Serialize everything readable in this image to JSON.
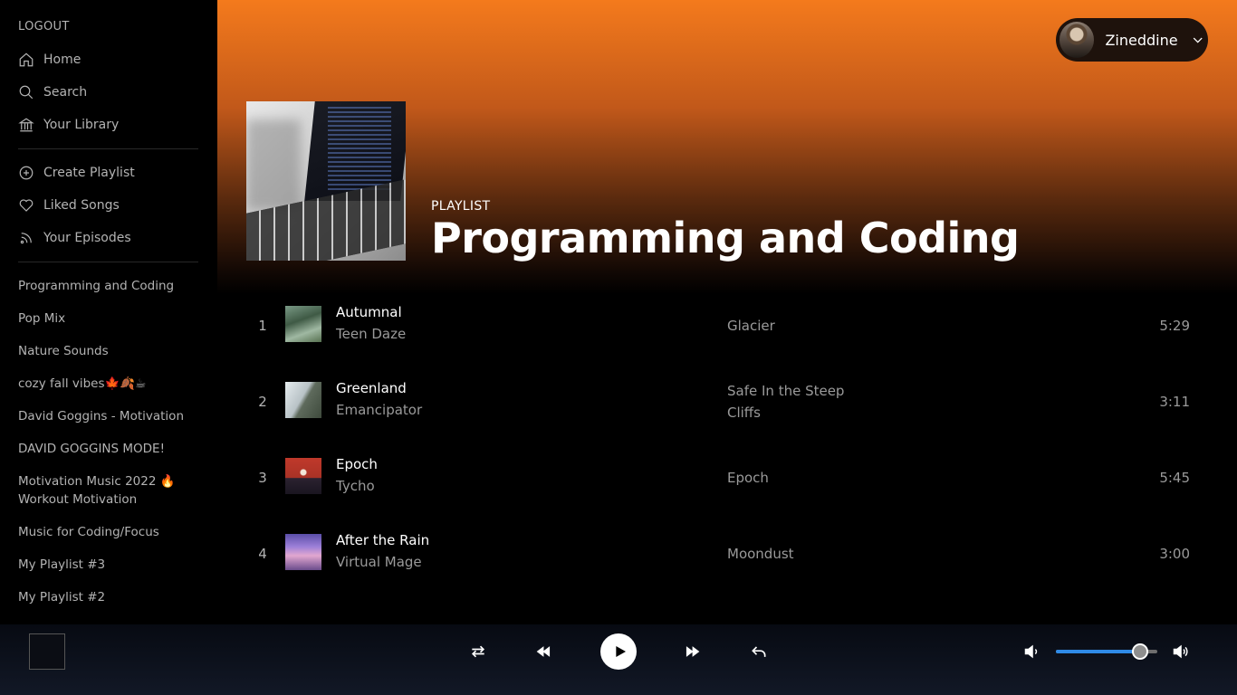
{
  "sidebar": {
    "logout_label": "LOGOUT",
    "nav": [
      {
        "label": "Home",
        "icon": "home-icon"
      },
      {
        "label": "Search",
        "icon": "search-icon"
      },
      {
        "label": "Your Library",
        "icon": "library-icon"
      }
    ],
    "actions": [
      {
        "label": "Create Playlist",
        "icon": "plus-circle-icon"
      },
      {
        "label": "Liked Songs",
        "icon": "heart-icon"
      },
      {
        "label": "Your Episodes",
        "icon": "rss-icon"
      }
    ],
    "playlists": [
      "Programming and Coding",
      "Pop Mix",
      "Nature Sounds",
      "cozy fall vibes🍁🍂☕",
      "David Goggins - Motivation",
      "DAVID GOGGINS MODE!",
      "Motivation Music 2022 🔥 Workout Motivation",
      "Music for Coding/Focus",
      "My Playlist #3",
      "My Playlist #2"
    ]
  },
  "header": {
    "user_name": "Zineddine",
    "gradient_color": "#f47a1c"
  },
  "playlist": {
    "label": "PLAYLIST",
    "title": "Programming and Coding"
  },
  "tracks": [
    {
      "number": "1",
      "title": "Autumnal",
      "artist": "Teen Daze",
      "album": "Glacier",
      "duration": "5:29"
    },
    {
      "number": "2",
      "title": "Greenland",
      "artist": "Emancipator",
      "album": "Safe In the Steep Cliffs",
      "duration": "3:11"
    },
    {
      "number": "3",
      "title": "Epoch",
      "artist": "Tycho",
      "album": "Epoch",
      "duration": "5:45"
    },
    {
      "number": "4",
      "title": "After the Rain",
      "artist": "Virtual Mage",
      "album": "Moondust",
      "duration": "3:00"
    }
  ],
  "player": {
    "controls": [
      "repeat-icon",
      "previous-icon",
      "play-icon",
      "next-icon",
      "undo-icon"
    ],
    "volume_fraction": 0.83,
    "accent": "#2f8ae6"
  }
}
